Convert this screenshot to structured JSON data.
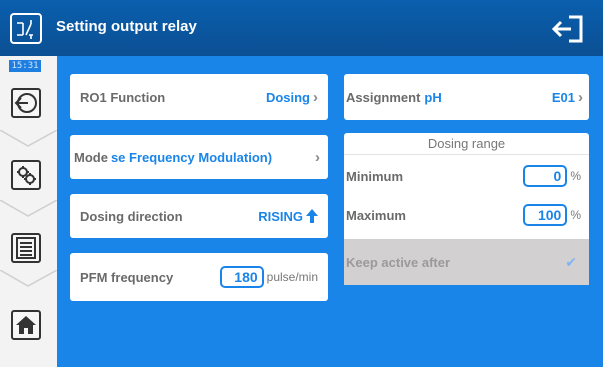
{
  "header": {
    "title": "Setting output relay"
  },
  "sidebar": {
    "clock": "15:31",
    "buttons": [
      "back-icon",
      "settings-icon",
      "menu-icon",
      "home-icon"
    ]
  },
  "cards": {
    "function": {
      "label": "RO1 Function",
      "value": "Dosing"
    },
    "mode": {
      "label": "Mode",
      "value": "se Frequency Modulation)"
    },
    "direction": {
      "label": "Dosing direction",
      "value": "RISING"
    },
    "pfm": {
      "label": "PFM frequency",
      "value": "180",
      "unit": "pulse/min"
    },
    "assignment": {
      "label": "Assignment",
      "param": "pH",
      "value": "E01"
    }
  },
  "dosing_range": {
    "title": "Dosing range",
    "minimum": {
      "label": "Minimum",
      "value": "0",
      "unit": "%"
    },
    "maximum": {
      "label": "Maximum",
      "value": "100",
      "unit": "%"
    },
    "keep_active": {
      "label": "Keep active after",
      "checked": true
    }
  },
  "colors": {
    "header": "#0b58a3",
    "accent": "#1a85e8",
    "panel": "#ffffff",
    "disabled": "#d3d0d2"
  }
}
